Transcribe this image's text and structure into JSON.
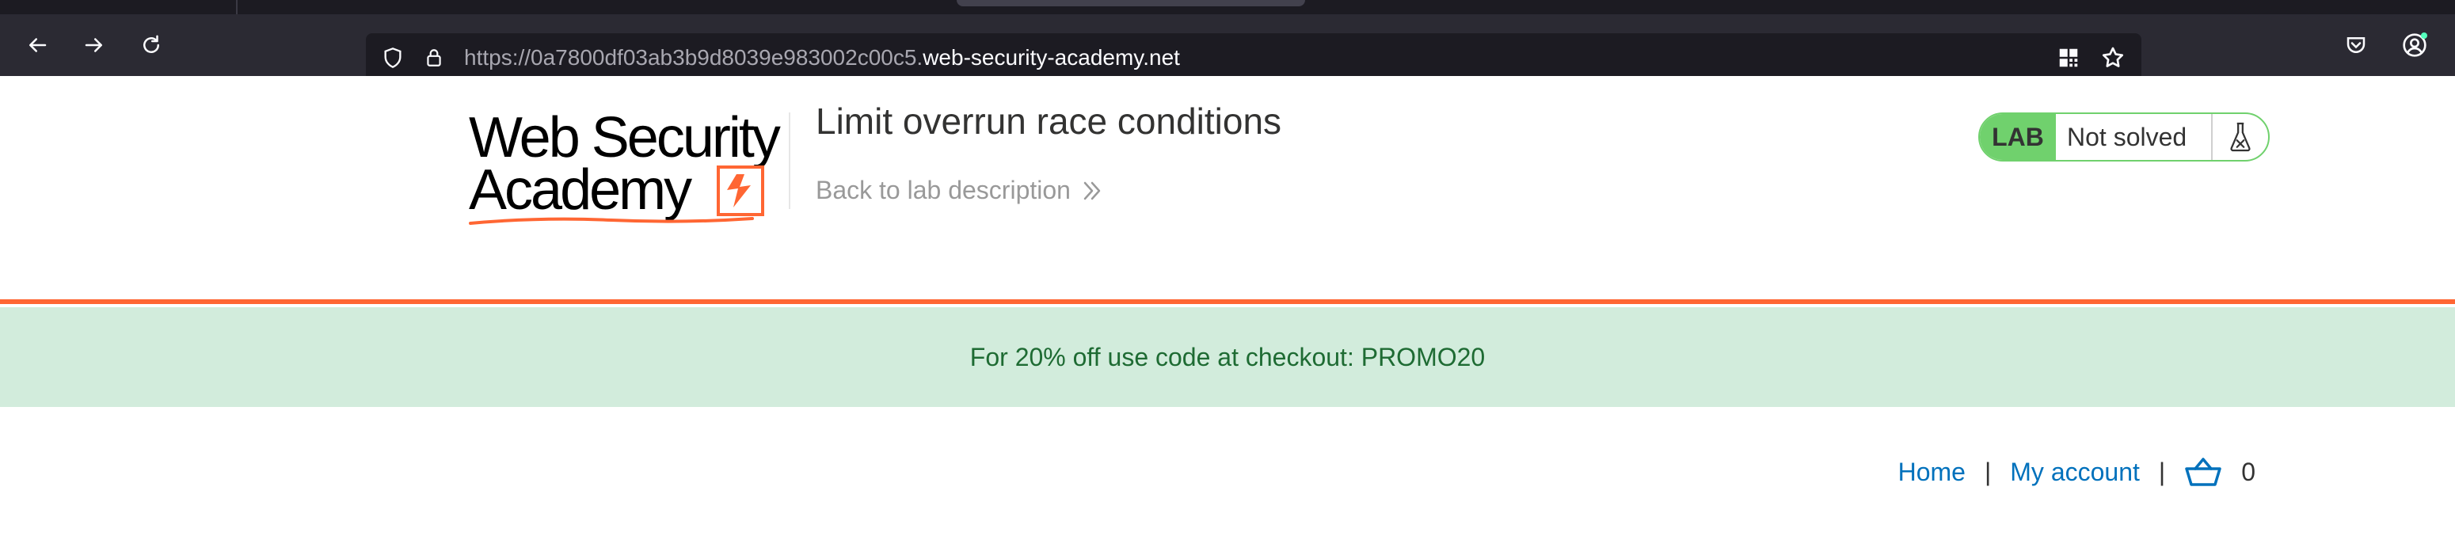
{
  "browser": {
    "url_prefix": "https://0a7800df03ab3b9d8039e983002c00c5.",
    "url_domain": "web-security-academy.net"
  },
  "header": {
    "logo_line1": "Web Security",
    "logo_line2": "Academy",
    "lab_title": "Limit overrun race conditions",
    "back_link": "Back to lab description",
    "lab_badge": "LAB",
    "lab_state": "Not solved"
  },
  "promo": {
    "text": "For 20% off use code at checkout: PROMO20"
  },
  "nav": {
    "home": "Home",
    "separator": "|",
    "my_account": "My account",
    "cart_count": "0"
  },
  "icons": [
    "back-icon",
    "forward-icon",
    "reload-icon",
    "shield-icon",
    "lock-icon",
    "qr-icon",
    "bookmark-star-icon",
    "pocket-icon",
    "account-icon",
    "chevrons-right-icon",
    "flask-icon",
    "basket-icon"
  ],
  "colors": {
    "accent_orange": "#ff6633",
    "lab_green": "#70d16d",
    "promo_bg": "#d2ecdc",
    "link_blue": "#0071bc"
  }
}
